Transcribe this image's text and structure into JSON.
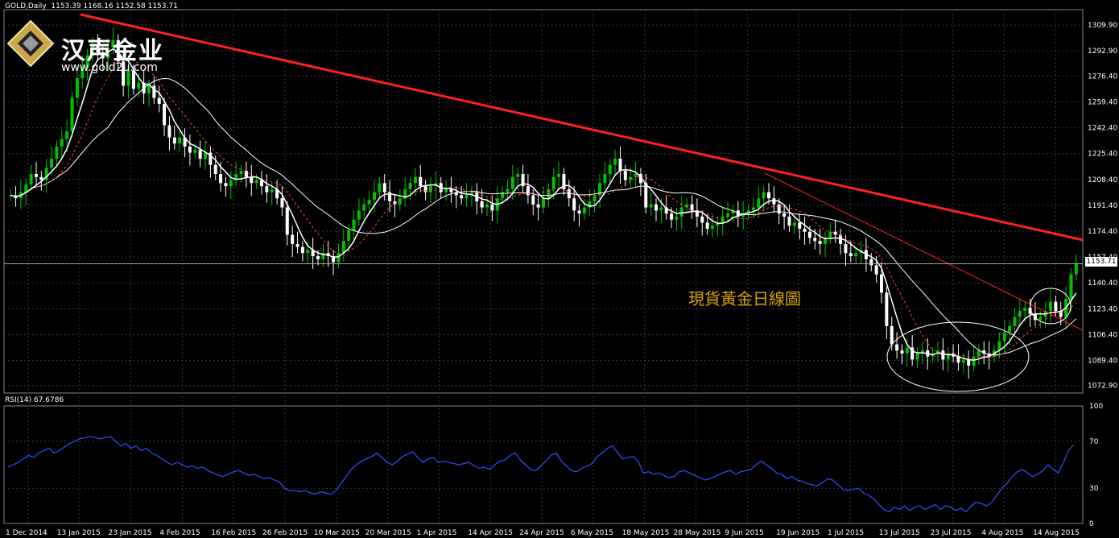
{
  "header": {
    "symbol_label": "GOLD,Daily",
    "ohlc": "1153.39 1168.16 1152.58 1153.71"
  },
  "logo": {
    "brand": "汉声金业",
    "url": "www.gold2u.com"
  },
  "annotation": "現貨黃金日線圖",
  "current_price_label": "1153.71",
  "rsi_header": "RSI(14) 67.6786",
  "colors": {
    "background": "#000000",
    "grid": "#3a3a3a",
    "candle_up": "#00c000",
    "candle_down": "#ffffff",
    "ma_fast": "#ffffff",
    "ma_slow": "#ffffff",
    "ma_dashed": "#ff4040",
    "trendline": "#ff2020",
    "rsi_line": "#3050ff",
    "annotation": "#d9a400"
  },
  "chart_data": [
    {
      "type": "candlestick",
      "y_ticks": [
        "1309.90",
        "1292.90",
        "1276.40",
        "1259.40",
        "1242.40",
        "1225.40",
        "1208.40",
        "1191.40",
        "1174.40",
        "1157.40",
        "1140.40",
        "1123.40",
        "1106.40",
        "1089.40",
        "1072.90"
      ],
      "x_ticks": [
        "1 Dec 2014",
        "13 Jan 2015",
        "23 Jan 2015",
        "4 Feb 2015",
        "16 Feb 2015",
        "26 Feb 2015",
        "10 Mar 2015",
        "20 Mar 2015",
        "1 Apr 2015",
        "14 Apr 2015",
        "24 Apr 2015",
        "6 May 2015",
        "18 May 2015",
        "28 May 2015",
        "9 Jun 2015",
        "19 Jun 2015",
        "1 Jul 2015",
        "13 Jul 2015",
        "23 Jul 2015",
        "4 Aug 2015",
        "14 Aug 2015"
      ],
      "ylim": [
        1068,
        1320
      ],
      "close_series": [
        1198,
        1196,
        1200,
        1205,
        1212,
        1210,
        1208,
        1216,
        1222,
        1230,
        1235,
        1240,
        1262,
        1275,
        1282,
        1290,
        1296,
        1292,
        1288,
        1295,
        1300,
        1286,
        1270,
        1280,
        1268,
        1272,
        1265,
        1270,
        1262,
        1258,
        1244,
        1236,
        1232,
        1236,
        1230,
        1226,
        1228,
        1222,
        1226,
        1218,
        1212,
        1206,
        1204,
        1208,
        1212,
        1214,
        1210,
        1206,
        1208,
        1204,
        1200,
        1202,
        1196,
        1190,
        1172,
        1166,
        1164,
        1160,
        1162,
        1158,
        1156,
        1160,
        1158,
        1154,
        1160,
        1168,
        1175,
        1182,
        1188,
        1192,
        1195,
        1200,
        1206,
        1200,
        1194,
        1192,
        1196,
        1202,
        1206,
        1210,
        1204,
        1200,
        1204,
        1206,
        1200,
        1202,
        1200,
        1198,
        1196,
        1198,
        1200,
        1194,
        1190,
        1192,
        1188,
        1196,
        1200,
        1202,
        1210,
        1212,
        1204,
        1198,
        1192,
        1190,
        1196,
        1202,
        1210,
        1212,
        1202,
        1196,
        1188,
        1186,
        1190,
        1194,
        1198,
        1206,
        1212,
        1218,
        1222,
        1214,
        1208,
        1210,
        1212,
        1206,
        1190,
        1192,
        1188,
        1190,
        1186,
        1182,
        1184,
        1190,
        1192,
        1188,
        1184,
        1180,
        1176,
        1178,
        1180,
        1184,
        1186,
        1188,
        1184,
        1186,
        1188,
        1190,
        1196,
        1200,
        1196,
        1192,
        1186,
        1184,
        1178,
        1180,
        1176,
        1174,
        1170,
        1168,
        1166,
        1170,
        1174,
        1172,
        1166,
        1160,
        1158,
        1160,
        1162,
        1156,
        1152,
        1146,
        1134,
        1112,
        1100,
        1096,
        1094,
        1098,
        1090,
        1094,
        1096,
        1092,
        1094,
        1096,
        1090,
        1094,
        1092,
        1088,
        1090,
        1086,
        1092,
        1096,
        1094,
        1092,
        1096,
        1102,
        1108,
        1112,
        1118,
        1122,
        1124,
        1120,
        1116,
        1118,
        1122,
        1128,
        1122,
        1118,
        1130,
        1146,
        1153
      ]
    },
    {
      "type": "line",
      "title": "RSI(14) 67.6786",
      "y_ticks": [
        "100",
        "70",
        "30",
        "0"
      ],
      "ylim": [
        0,
        100
      ],
      "values": [
        48,
        50,
        52,
        55,
        58,
        56,
        60,
        62,
        64,
        60,
        62,
        65,
        68,
        70,
        72,
        73,
        74,
        73,
        72,
        73,
        74,
        70,
        66,
        68,
        64,
        66,
        62,
        64,
        60,
        58,
        55,
        52,
        50,
        52,
        50,
        48,
        49,
        47,
        48,
        45,
        43,
        41,
        40,
        42,
        44,
        45,
        43,
        41,
        42,
        40,
        38,
        39,
        37,
        35,
        30,
        28,
        28,
        27,
        28,
        26,
        25,
        27,
        26,
        25,
        28,
        34,
        40,
        46,
        50,
        53,
        55,
        57,
        60,
        56,
        52,
        50,
        53,
        57,
        59,
        61,
        56,
        52,
        55,
        56,
        52,
        53,
        52,
        51,
        50,
        51,
        52,
        49,
        47,
        48,
        46,
        50,
        53,
        54,
        58,
        60,
        54,
        50,
        46,
        45,
        49,
        53,
        58,
        60,
        53,
        49,
        45,
        44,
        47,
        49,
        51,
        57,
        60,
        64,
        66,
        60,
        55,
        56,
        57,
        53,
        43,
        44,
        42,
        43,
        41,
        39,
        40,
        44,
        45,
        43,
        41,
        39,
        37,
        38,
        40,
        42,
        44,
        45,
        42,
        44,
        45,
        46,
        50,
        53,
        50,
        47,
        43,
        42,
        38,
        40,
        37,
        36,
        34,
        33,
        32,
        35,
        38,
        37,
        33,
        29,
        28,
        29,
        30,
        26,
        24,
        21,
        16,
        12,
        10,
        14,
        12,
        15,
        11,
        14,
        15,
        12,
        14,
        16,
        12,
        15,
        14,
        11,
        13,
        10,
        15,
        18,
        17,
        15,
        18,
        24,
        30,
        34,
        40,
        44,
        46,
        43,
        40,
        42,
        45,
        50,
        46,
        43,
        52,
        62,
        67
      ]
    }
  ]
}
